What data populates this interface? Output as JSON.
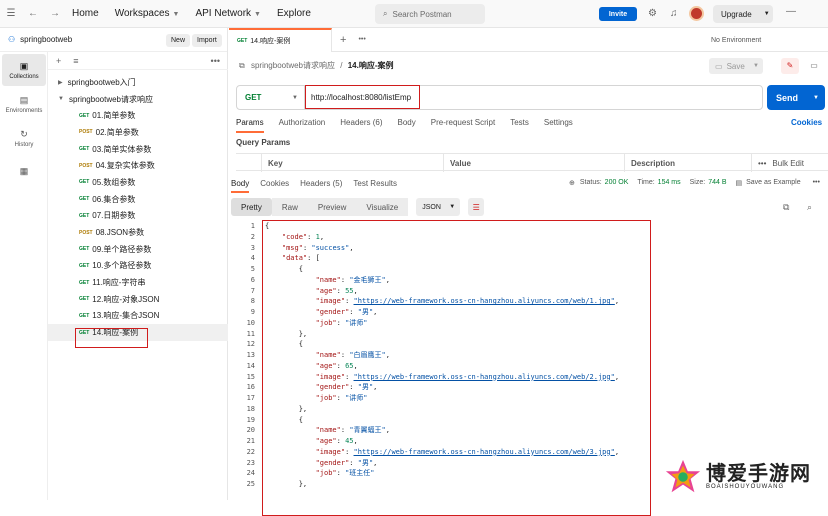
{
  "topbar": {
    "nav": [
      "Home",
      "Workspaces",
      "API Network",
      "Explore"
    ],
    "search_placeholder": "Search Postman",
    "invite": "Invite",
    "upgrade": "Upgrade"
  },
  "workspace": {
    "name": "springbootweb",
    "new_label": "New",
    "import_label": "Import"
  },
  "rail": [
    {
      "label": "Collections",
      "icon": "collections-icon"
    },
    {
      "label": "Environments",
      "icon": "environments-icon"
    },
    {
      "label": "History",
      "icon": "history-icon"
    },
    {
      "label": "",
      "icon": "apps-icon"
    }
  ],
  "tree": {
    "folders": [
      "springbootweb入门",
      "springbootweb请求响应"
    ],
    "requests": [
      {
        "method": "GET",
        "name": "01.简单参数"
      },
      {
        "method": "POST",
        "name": "02.简单参数"
      },
      {
        "method": "GET",
        "name": "03.简单实体参数"
      },
      {
        "method": "POST",
        "name": "04.复杂实体参数"
      },
      {
        "method": "GET",
        "name": "05.数组参数"
      },
      {
        "method": "GET",
        "name": "06.集合参数"
      },
      {
        "method": "GET",
        "name": "07.日期参数"
      },
      {
        "method": "POST",
        "name": "08.JSON参数"
      },
      {
        "method": "GET",
        "name": "09.单个路径参数"
      },
      {
        "method": "GET",
        "name": "10.多个路径参数"
      },
      {
        "method": "GET",
        "name": "11.响应-字符串"
      },
      {
        "method": "GET",
        "name": "12.响应-对象JSON"
      },
      {
        "method": "GET",
        "name": "13.响应-集合JSON"
      },
      {
        "method": "GET",
        "name": "14.响应-案例"
      }
    ]
  },
  "tab": {
    "method": "GET",
    "name": "14.响应-案例",
    "env": "No Environment"
  },
  "breadcrumb": {
    "parent": "springbootweb请求响应",
    "sep": "/",
    "current": "14.响应-案例",
    "save": "Save"
  },
  "request": {
    "method": "GET",
    "url": "http://localhost:8080/listEmp",
    "send": "Send"
  },
  "req_tabs": [
    "Params",
    "Authorization",
    "Headers (6)",
    "Body",
    "Pre-request Script",
    "Tests",
    "Settings"
  ],
  "cookies": "Cookies",
  "query_params": {
    "title": "Query Params",
    "cols": [
      "Key",
      "Value",
      "Description"
    ],
    "bulk": "Bulk Edit"
  },
  "resp_tabs": [
    "Body",
    "Cookies",
    "Headers (5)",
    "Test Results"
  ],
  "status": {
    "status_label": "Status:",
    "status": "200 OK",
    "time_label": "Time:",
    "time": "154 ms",
    "size_label": "Size:",
    "size": "744 B",
    "save_example": "Save as Example"
  },
  "format": {
    "options": [
      "Pretty",
      "Raw",
      "Preview",
      "Visualize"
    ],
    "lang": "JSON"
  },
  "code_lines": [
    "{",
    "    \"code\": 1,",
    "    \"msg\": \"success\",",
    "    \"data\": [",
    "        {",
    "            \"name\": \"金毛狮王\",",
    "            \"age\": 55,",
    "            \"image\": \"https://web-framework.oss-cn-hangzhou.aliyuncs.com/web/1.jpg\",",
    "            \"gender\": \"男\",",
    "            \"job\": \"讲师\"",
    "        },",
    "        {",
    "            \"name\": \"白眉鹰王\",",
    "            \"age\": 65,",
    "            \"image\": \"https://web-framework.oss-cn-hangzhou.aliyuncs.com/web/2.jpg\",",
    "            \"gender\": \"男\",",
    "            \"job\": \"讲师\"",
    "        },",
    "        {",
    "            \"name\": \"青翼蝠王\",",
    "            \"age\": 45,",
    "            \"image\": \"https://web-framework.oss-cn-hangzhou.aliyuncs.com/web/3.jpg\",",
    "            \"gender\": \"男\",",
    "            \"job\": \"班主任\"",
    "        },"
  ],
  "watermark": {
    "title": "博爱手游网",
    "sub": "BOAISHOUYOUWANG"
  }
}
